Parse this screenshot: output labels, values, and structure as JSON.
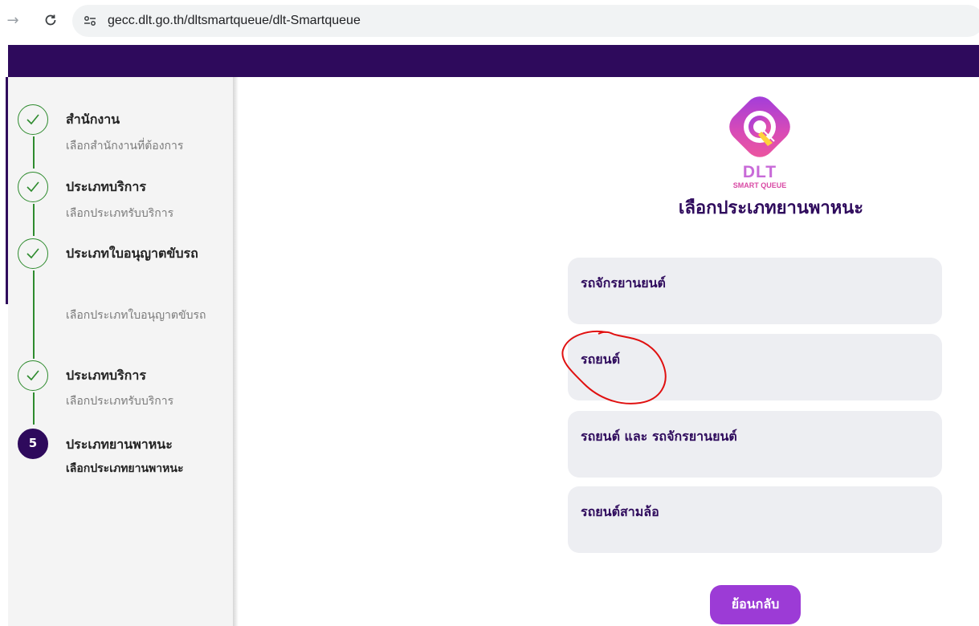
{
  "browser": {
    "url": "gecc.dlt.go.th/dltsmartqueue/dlt-Smartqueue"
  },
  "sidebar": {
    "steps": [
      {
        "title": "สำนักงาน",
        "subtitle": "เลือกสำนักงานที่ต้องการ",
        "status": "done"
      },
      {
        "title": "ประเภทบริการ",
        "subtitle": "เลือกประเภทรับบริการ",
        "status": "done"
      },
      {
        "title": "ประเภทใบอนุญาตขับรถ",
        "subtitle": "เลือกประเภทใบอนุญาตขับรถ",
        "status": "done"
      },
      {
        "title": "ประเภทบริการ",
        "subtitle": "เลือกประเภทรับบริการ",
        "status": "done"
      },
      {
        "number": "5",
        "title": "ประเภทยานพาหนะ",
        "subtitle": "เลือกประเภทยานพาหนะ",
        "status": "active"
      }
    ]
  },
  "logo": {
    "letter": "Q",
    "text": "DLT",
    "subtext": "SMART QUEUE"
  },
  "main": {
    "title": "เลือกประเภทยานพาหนะ",
    "options": [
      {
        "label": "รถจักรยานยนต์"
      },
      {
        "label": "รถยนต์"
      },
      {
        "label": "รถยนต์ และ รถจักรยานยนต์"
      },
      {
        "label": "รถยนต์สามล้อ"
      }
    ],
    "back_label": "ย้อนกลับ"
  },
  "colors": {
    "brand_purple": "#2e0a5c",
    "button_purple": "#9c3bd6",
    "done_green": "#2e8b2e",
    "option_bg": "#edeef2",
    "annotation_red": "#e01010"
  }
}
